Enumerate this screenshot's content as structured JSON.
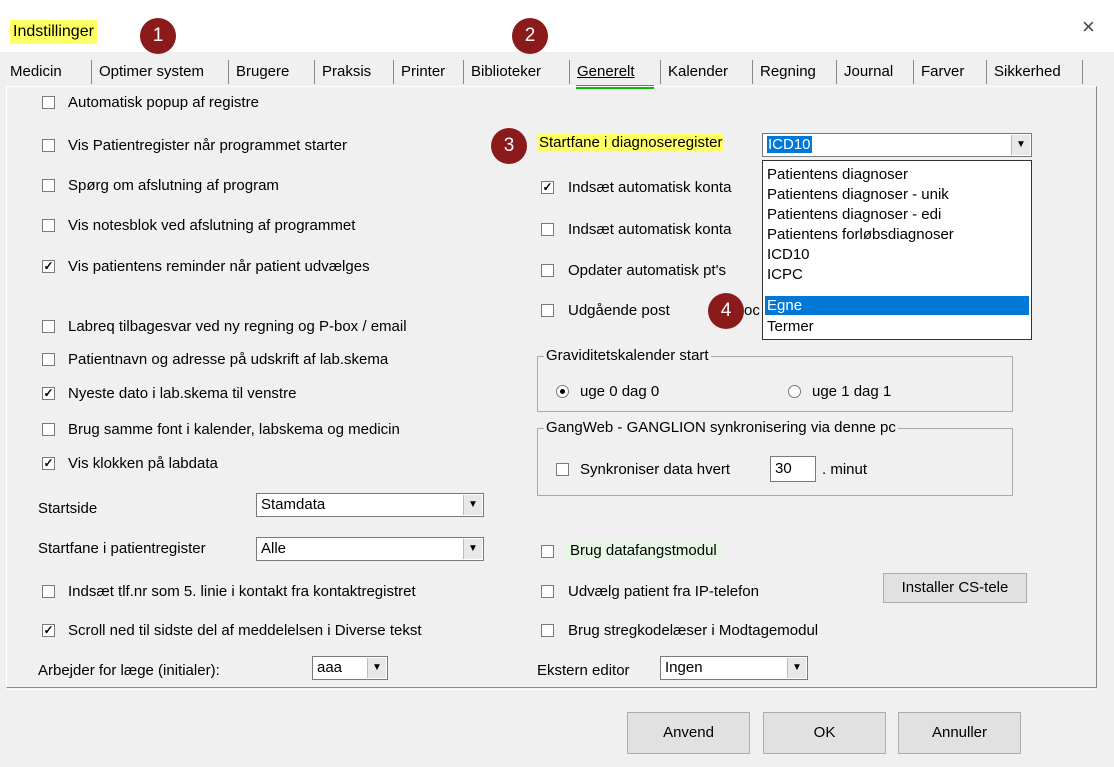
{
  "window": {
    "title": "Indstillinger",
    "close_glyph": "×"
  },
  "badges": [
    "1",
    "2",
    "3",
    "4"
  ],
  "tabs": [
    "Medicin",
    "Optimer system",
    "Brugere",
    "Praksis",
    "Printer",
    "Biblioteker",
    "Generelt",
    "Kalender",
    "Regning",
    "Journal",
    "Farver",
    "Sikkerhed"
  ],
  "active_tab": "Generelt",
  "left": {
    "checkboxes": [
      {
        "label": "Automatisk popup af registre",
        "checked": false
      },
      {
        "label": "Vis Patientregister når programmet starter",
        "checked": false
      },
      {
        "label": "Spørg om afslutning af program",
        "checked": false
      },
      {
        "label": "Vis notesblok ved afslutning af programmet",
        "checked": false
      },
      {
        "label": "Vis patientens reminder når patient udvælges",
        "checked": true
      },
      {
        "label": "Labreq tilbagesvar ved ny regning og P-box / email",
        "checked": false
      },
      {
        "label": "Patientnavn og adresse på udskrift af lab.skema",
        "checked": false
      },
      {
        "label": "Nyeste dato i lab.skema til venstre",
        "checked": true
      },
      {
        "label": "Brug samme font i kalender, labskema og medicin",
        "checked": false
      },
      {
        "label": "Vis klokken på labdata",
        "checked": true
      },
      {
        "label": "Indsæt tlf.nr som 5. linie i kontakt fra kontaktregistret",
        "checked": false
      },
      {
        "label": "Scroll ned til sidste del af meddelelsen i Diverse tekst",
        "checked": true
      }
    ],
    "startside": {
      "label": "Startside",
      "value": "Stamdata"
    },
    "startfane_patient": {
      "label": "Startfane i patientregister",
      "value": "Alle"
    },
    "arbejder": {
      "label": "Arbejder for læge (initialer):",
      "value": "aaa"
    }
  },
  "right": {
    "startfane_diagnose": {
      "label": "Startfane i diagnoseregister",
      "value": "ICD10"
    },
    "checkboxes": [
      {
        "label": "Indsæt automatisk konta",
        "checked": true
      },
      {
        "label": "Indsæt automatisk konta",
        "checked": false
      },
      {
        "label": "Opdater automatisk pt's",
        "checked": false
      },
      {
        "label": "Udgående post",
        "suffix": "oc",
        "checked": false
      }
    ],
    "dropdown_options": [
      "Patientens diagnoser",
      "Patientens diagnoser - unik",
      "Patientens diagnoser - edi",
      "Patientens forløbsdiagnoser",
      "ICD10",
      "ICPC",
      "Egne",
      "Termer"
    ],
    "dropdown_selected": "Egne",
    "graviditet": {
      "title": "Graviditetskalender start",
      "option1": "uge 0 dag 0",
      "option2": "uge 1 dag 1",
      "selected": "uge 0 dag 0"
    },
    "gangweb": {
      "title": "GangWeb - GANGLION synkronisering via denne pc",
      "label": "Synkroniser data hvert",
      "value": "30",
      "unit": ". minut"
    },
    "datafangst": {
      "label": "Brug datafangstmodul",
      "checked": false
    },
    "ip_telefon": {
      "label": "Udvælg patient fra IP-telefon",
      "checked": false
    },
    "installer_btn": "Installer CS-tele",
    "stregkode": {
      "label": "Brug stregkodelæser i Modtagemodul",
      "checked": false
    },
    "ekstern_editor": {
      "label": "Ekstern editor",
      "value": "Ingen"
    }
  },
  "footer": {
    "apply": "Anvend",
    "ok": "OK",
    "cancel": "Annuller"
  },
  "colors": {
    "highlight": "#ffff66",
    "badge": "#8b1a1a",
    "selection": "#0078d7",
    "active_tab_underline": "#00c000"
  }
}
